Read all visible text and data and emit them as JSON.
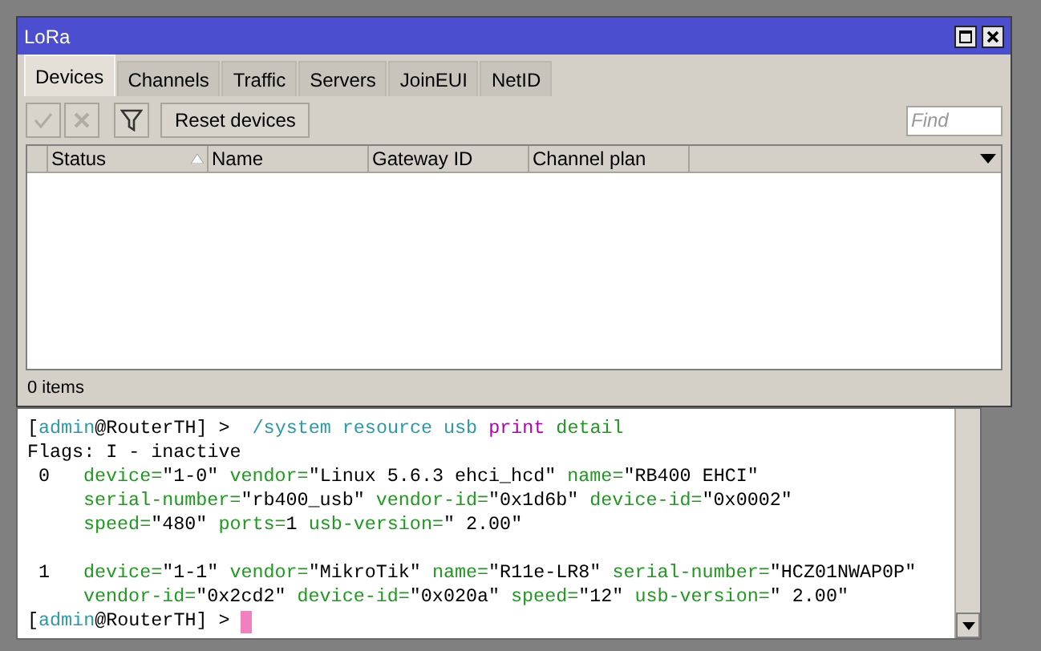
{
  "window": {
    "title": "LoRa"
  },
  "tabs": [
    {
      "label": "Devices",
      "selected": true
    },
    {
      "label": "Channels",
      "selected": false
    },
    {
      "label": "Traffic",
      "selected": false
    },
    {
      "label": "Servers",
      "selected": false
    },
    {
      "label": "JoinEUI",
      "selected": false
    },
    {
      "label": "NetID",
      "selected": false
    }
  ],
  "toolbar": {
    "icon_buttons": [
      {
        "kind": "enable",
        "disabled": true
      },
      {
        "kind": "disable",
        "disabled": true
      },
      {
        "kind": "filter",
        "disabled": false
      }
    ],
    "reset_button": "Reset devices",
    "find": {
      "placeholder": "Find"
    }
  },
  "table": {
    "columns": [
      {
        "label": "Status",
        "sorted": true
      },
      {
        "label": "Name",
        "sorted": false
      },
      {
        "label": "Gateway ID",
        "sorted": false
      },
      {
        "label": "Channel plan",
        "sorted": false
      }
    ]
  },
  "status_bar": "0 items",
  "terminal": {
    "command_line": [
      {
        "kind": "bracket",
        "text": "["
      },
      {
        "kind": "user",
        "text": "admin"
      },
      {
        "kind": "plain",
        "text": "@RouterTH] >  "
      },
      {
        "kind": "path",
        "text": "/system resource usb "
      },
      {
        "kind": "verb",
        "text": "print"
      },
      {
        "kind": "key",
        "text": " detail"
      }
    ],
    "flags": "Flags: I - inactive",
    "entries": [
      {
        "index": "0",
        "lines": [
          [
            {
              "kind": "key",
              "text": "device="
            },
            {
              "kind": "plain",
              "text": "\"1-0\" "
            },
            {
              "kind": "key",
              "text": "vendor="
            },
            {
              "kind": "plain",
              "text": "\"Linux 5.6.3 ehci_hcd\" "
            },
            {
              "kind": "key",
              "text": "name="
            },
            {
              "kind": "plain",
              "text": "\"RB400 EHCI\""
            }
          ],
          [
            {
              "kind": "key",
              "text": "serial-number="
            },
            {
              "kind": "plain",
              "text": "\"rb400_usb\" "
            },
            {
              "kind": "key",
              "text": "vendor-id="
            },
            {
              "kind": "plain",
              "text": "\"0x1d6b\" "
            },
            {
              "kind": "key",
              "text": "device-id="
            },
            {
              "kind": "plain",
              "text": "\"0x0002\""
            }
          ],
          [
            {
              "kind": "key",
              "text": "speed="
            },
            {
              "kind": "plain",
              "text": "\"480\" "
            },
            {
              "kind": "key",
              "text": "ports="
            },
            {
              "kind": "plain",
              "text": "1 "
            },
            {
              "kind": "key",
              "text": "usb-version="
            },
            {
              "kind": "plain",
              "text": "\" 2.00\""
            }
          ]
        ]
      },
      {
        "index": "1",
        "lines": [
          [
            {
              "kind": "key",
              "text": "device="
            },
            {
              "kind": "plain",
              "text": "\"1-1\" "
            },
            {
              "kind": "key",
              "text": "vendor="
            },
            {
              "kind": "plain",
              "text": "\"MikroTik\" "
            },
            {
              "kind": "key",
              "text": "name="
            },
            {
              "kind": "plain",
              "text": "\"R11e-LR8\" "
            },
            {
              "kind": "key",
              "text": "serial-number="
            },
            {
              "kind": "plain",
              "text": "\"HCZ01NWAP0P\""
            }
          ],
          [
            {
              "kind": "key",
              "text": "vendor-id="
            },
            {
              "kind": "plain",
              "text": "\"0x2cd2\" "
            },
            {
              "kind": "key",
              "text": "device-id="
            },
            {
              "kind": "plain",
              "text": "\"0x020a\" "
            },
            {
              "kind": "key",
              "text": "speed="
            },
            {
              "kind": "plain",
              "text": "\"12\" "
            },
            {
              "kind": "key",
              "text": "usb-version="
            },
            {
              "kind": "plain",
              "text": "\" 2.00\""
            }
          ]
        ]
      }
    ],
    "prompt": [
      {
        "kind": "bracket",
        "text": "["
      },
      {
        "kind": "user",
        "text": "admin"
      },
      {
        "kind": "plain",
        "text": "@RouterTH] > "
      }
    ]
  }
}
